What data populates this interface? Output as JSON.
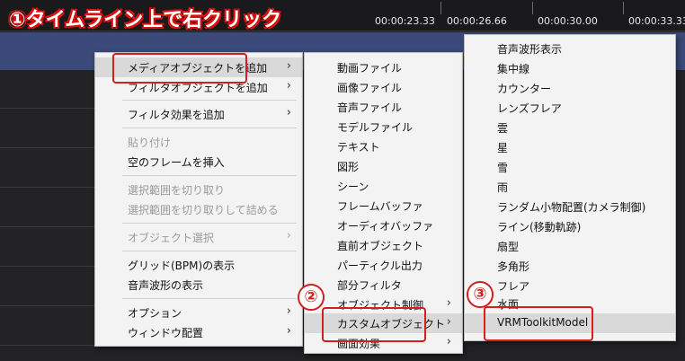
{
  "timeline": {
    "time_labels": [
      "00:00:23.33",
      "00:00:26.66",
      "00:00:30.00",
      "00:00:33.33"
    ]
  },
  "annotations": {
    "step1": "①タイムライン上で右クリック",
    "step2": "②",
    "step3": "③",
    "highlight_color": "#d12020"
  },
  "context_menu": {
    "items": [
      {
        "label": "メディアオブジェクトを追加",
        "submenu": true,
        "enabled": true
      },
      {
        "label": "フィルタオブジェクトを追加",
        "submenu": true,
        "enabled": true
      },
      {
        "label": "フィルタ効果を追加",
        "submenu": true,
        "enabled": true
      },
      {
        "label": "貼り付け",
        "submenu": false,
        "enabled": false
      },
      {
        "label": "空のフレームを挿入",
        "submenu": false,
        "enabled": true
      },
      {
        "label": "選択範囲を切り取り",
        "submenu": false,
        "enabled": false
      },
      {
        "label": "選択範囲を切り取りして詰める",
        "submenu": false,
        "enabled": false
      },
      {
        "label": "オブジェクト選択",
        "submenu": true,
        "enabled": false
      },
      {
        "label": "グリッド(BPM)の表示",
        "submenu": false,
        "enabled": true
      },
      {
        "label": "音声波形の表示",
        "submenu": false,
        "enabled": true
      },
      {
        "label": "オプション",
        "submenu": true,
        "enabled": true
      },
      {
        "label": "ウィンドウ配置",
        "submenu": true,
        "enabled": true
      }
    ]
  },
  "media_submenu": {
    "items": [
      {
        "label": "動画ファイル"
      },
      {
        "label": "画像ファイル"
      },
      {
        "label": "音声ファイル"
      },
      {
        "label": "モデルファイル"
      },
      {
        "label": "テキスト"
      },
      {
        "label": "図形"
      },
      {
        "label": "シーン"
      },
      {
        "label": "フレームバッファ"
      },
      {
        "label": "オーディオバッファ"
      },
      {
        "label": "直前オブジェクト"
      },
      {
        "label": "パーティクル出力"
      },
      {
        "label": "部分フィルタ"
      },
      {
        "label": "オブジェクト制御"
      },
      {
        "label": "カスタムオブジェクト"
      },
      {
        "label": "画面効果"
      }
    ]
  },
  "custom_submenu": {
    "items": [
      {
        "label": "音声波形表示"
      },
      {
        "label": "集中線"
      },
      {
        "label": "カウンター"
      },
      {
        "label": "レンズフレア"
      },
      {
        "label": "雲"
      },
      {
        "label": "星"
      },
      {
        "label": "雪"
      },
      {
        "label": "雨"
      },
      {
        "label": "ランダム小物配置(カメラ制御)"
      },
      {
        "label": "ライン(移動軌跡)"
      },
      {
        "label": "扇型"
      },
      {
        "label": "多角形"
      },
      {
        "label": "フレア"
      },
      {
        "label": "水面"
      },
      {
        "label": "VRMToolkitModel"
      }
    ]
  }
}
